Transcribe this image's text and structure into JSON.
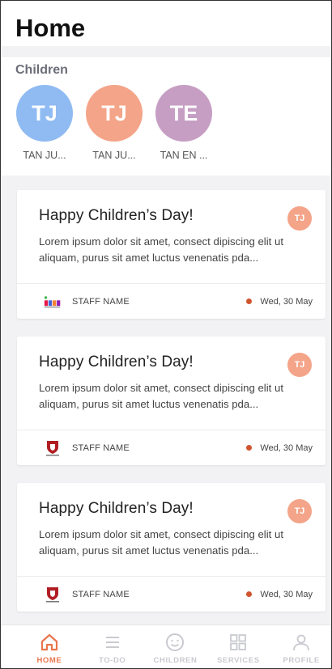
{
  "header": {
    "title": "Home"
  },
  "children": {
    "label": "Children",
    "items": [
      {
        "initials": "TJ",
        "name": "TAN JU...",
        "color": "#8fbbf2"
      },
      {
        "initials": "TJ",
        "name": "TAN JU...",
        "color": "#f4a488"
      },
      {
        "initials": "TE",
        "name": "TAN EN ...",
        "color": "#c69ec3"
      }
    ]
  },
  "feed": {
    "cards": [
      {
        "title": "Happy Children’s Day!",
        "text": "Lorem ipsum dolor sit amet, consect dipiscing elit ut aliquam, purus sit amet luctus venenatis pda...",
        "badge": "TJ",
        "staff": "STAFF NAME",
        "date": "Wed, 30 May",
        "logo": "colorful-school-logo-icon"
      },
      {
        "title": "Happy Children’s Day!",
        "text": "Lorem ipsum dolor sit amet, consect dipiscing elit ut aliquam, purus sit amet luctus venenatis pda...",
        "badge": "TJ",
        "staff": "STAFF NAME",
        "date": "Wed, 30 May",
        "logo": "crest-logo-icon"
      },
      {
        "title": "Happy Children’s Day!",
        "text": "Lorem ipsum dolor sit amet, consect dipiscing elit ut aliquam, purus sit amet luctus venenatis pda...",
        "badge": "TJ",
        "staff": "STAFF NAME",
        "date": "Wed, 30 May",
        "logo": "crest-logo-icon"
      }
    ]
  },
  "tabbar": {
    "tabs": [
      {
        "label": "HOME",
        "icon": "home-icon",
        "active": true
      },
      {
        "label": "TO-DO",
        "icon": "list-icon",
        "active": false
      },
      {
        "label": "CHILDREN",
        "icon": "smiley-icon",
        "active": false
      },
      {
        "label": "SERVICES",
        "icon": "grid-icon",
        "active": false
      },
      {
        "label": "PROFILE",
        "icon": "person-icon",
        "active": false
      }
    ]
  },
  "colors": {
    "accent": "#e8764e",
    "badge": "#f4a488",
    "date_dot": "#d0542f",
    "inactive_tab": "#c9cad0"
  }
}
